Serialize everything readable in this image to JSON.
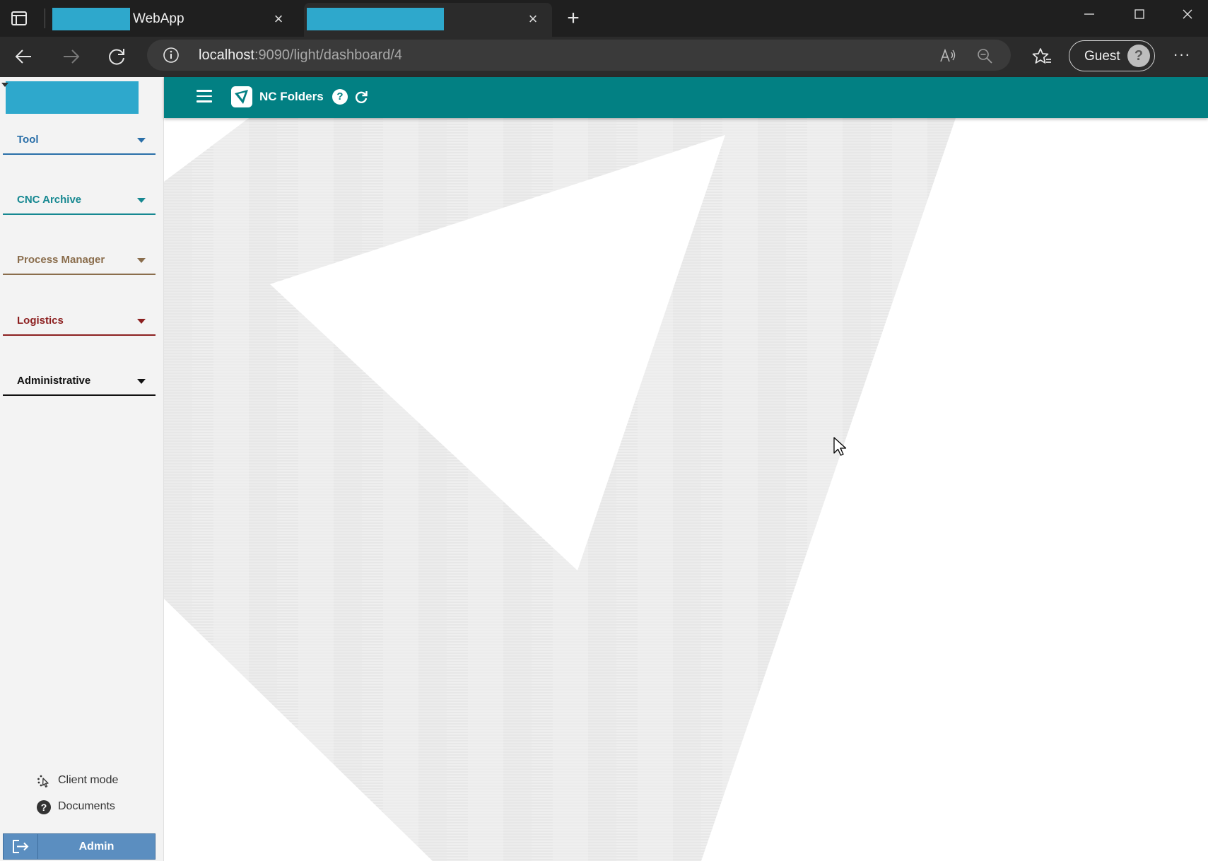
{
  "browser": {
    "tabs": [
      {
        "title": "WebApp",
        "close_label": "×"
      },
      {
        "title": "",
        "close_label": "×"
      }
    ],
    "new_tab_label": "+",
    "window": {
      "minimize": "—",
      "maximize": "☐",
      "close": "✕"
    },
    "address": {
      "host": "localhost",
      "rest": ":9090/light/dashboard/4"
    },
    "profile": {
      "label": "Guest",
      "avatar_glyph": "?"
    },
    "more_label": "···"
  },
  "sidebar": {
    "menu": [
      {
        "label": "Tool",
        "color": "#2a6fa8"
      },
      {
        "label": "CNC Archive",
        "color": "#168891"
      },
      {
        "label": "Process Manager",
        "color": "#8a6d4c"
      },
      {
        "label": "Logistics",
        "color": "#8c1f1f"
      },
      {
        "label": "Administrative",
        "color": "#111111"
      }
    ],
    "footer": {
      "client_mode": "Client mode",
      "documents": "Documents",
      "documents_icon_glyph": "?"
    },
    "user": {
      "label": "Admin"
    }
  },
  "header": {
    "title": "NC Folders",
    "help_glyph": "?"
  },
  "theme": {
    "accent": "#028083",
    "logo_placeholder": "#2ea8cc",
    "admin_bar": "#5b8ec0"
  }
}
